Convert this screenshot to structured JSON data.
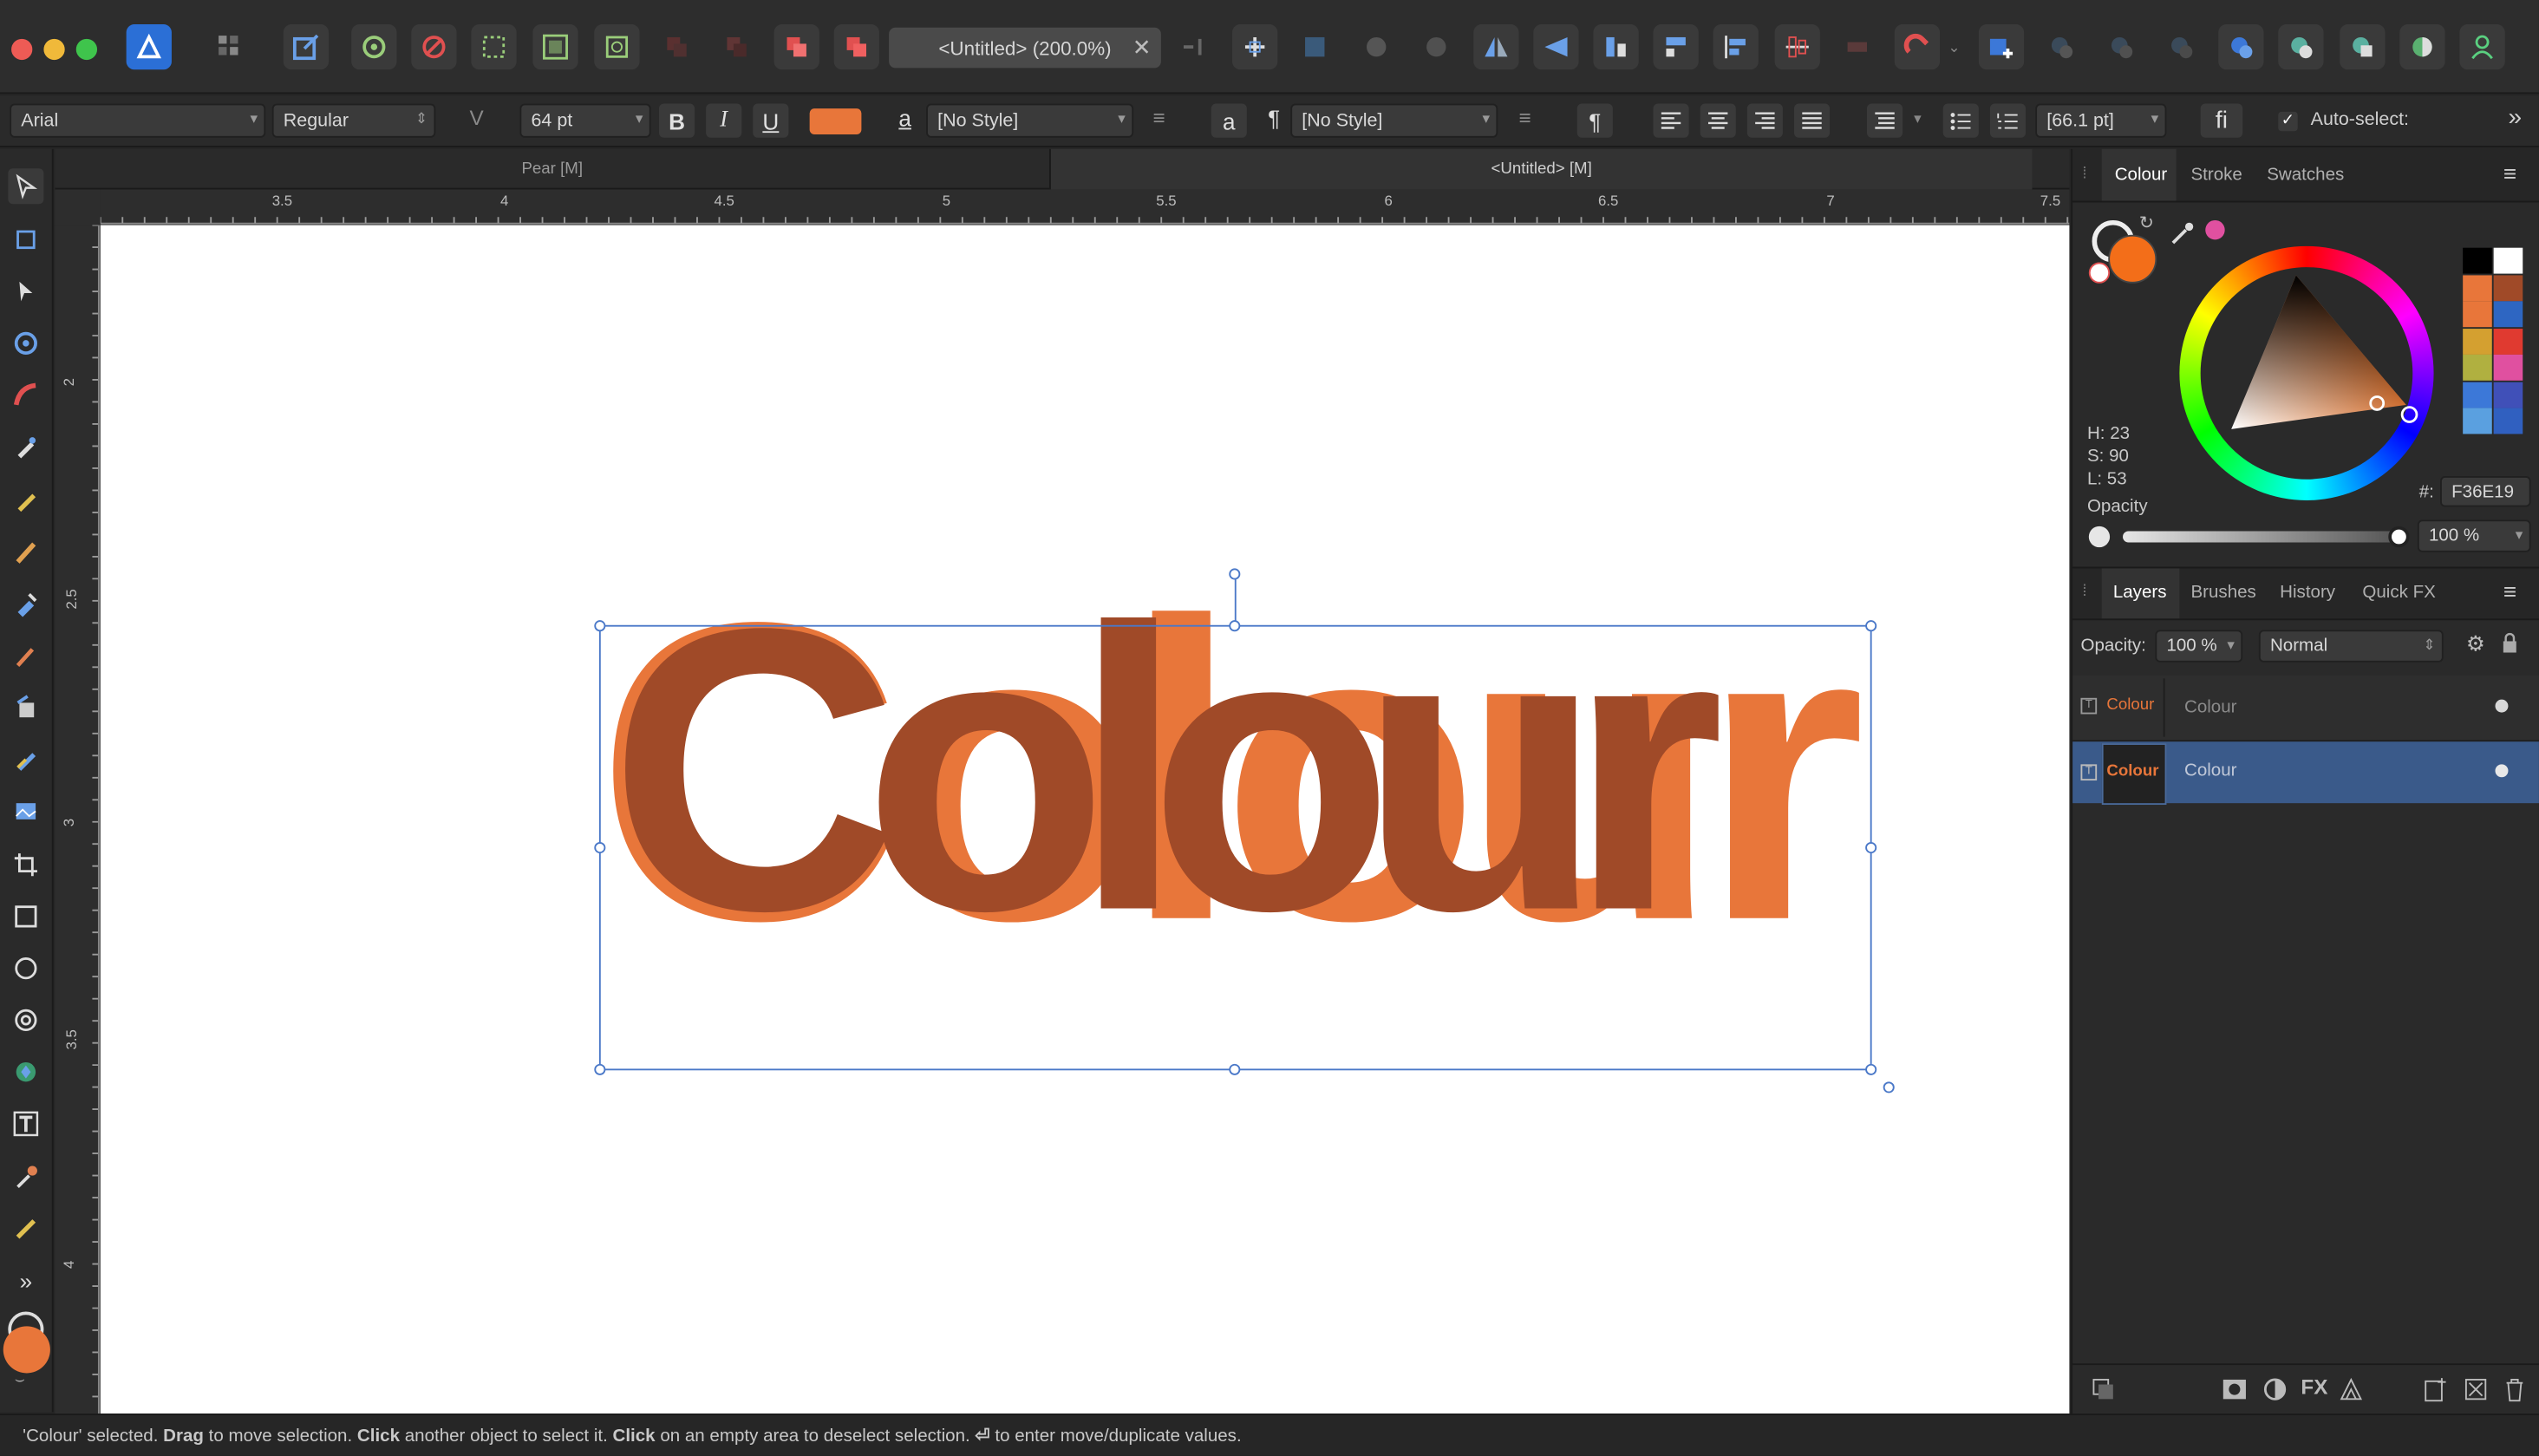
{
  "toolbar": {
    "document_title": "<Untitled> (200.0%)",
    "close_glyph": "✕"
  },
  "context_bar": {
    "font_family": "Arial",
    "font_style": "Regular",
    "font_size": "64 pt",
    "bold": "B",
    "italic": "I",
    "underline": "U",
    "fill_color": "#E8763A",
    "char_style_glyph": "a",
    "char_style": "[No Style]",
    "char_style2_glyph": "a",
    "para_glyph": "¶",
    "para_style": "[No Style]",
    "pilcrow_btn": "¶",
    "leading": "[66.1 pt]",
    "ligature": "fi",
    "auto_select_label": "Auto-select:",
    "more_glyph": "»"
  },
  "doc_tabs": [
    {
      "label": "Pear  [M]"
    },
    {
      "label": "<Untitled> [M]"
    }
  ],
  "ruler": {
    "unit": "in",
    "h_labels": [
      "3.5",
      "4",
      "4.5",
      "5",
      "5.5",
      "6",
      "6.5",
      "7",
      "7.5"
    ],
    "v_labels": [
      "2",
      "2.5",
      "3",
      "3.5",
      "4"
    ]
  },
  "canvas": {
    "text": "Colour",
    "colors": {
      "light": "#E8763A",
      "dark": "#A04A28"
    }
  },
  "colour_panel": {
    "tabs": [
      "Colour",
      "Stroke",
      "Swatches"
    ],
    "h": "H: 23",
    "s": "S: 90",
    "l": "L: 53",
    "hex_label": "#:",
    "hex_value": "F36E19",
    "opacity_label": "Opacity",
    "opacity_value": "100 %",
    "swatches": [
      "#000000",
      "#ffffff",
      "#E8763A",
      "#A04A28",
      "#E8763A",
      "#2E66C2",
      "#D4A030",
      "#E03A30",
      "#B0B040",
      "#E050A0",
      "#3C78D8",
      "#4050B8",
      "#5AA0E0",
      "#3060C0"
    ]
  },
  "layers_panel": {
    "tabs": [
      "Layers",
      "Brushes",
      "History",
      "Quick FX"
    ],
    "opacity_label": "Opacity:",
    "opacity_value": "100 %",
    "blend_mode": "Normal",
    "layers": [
      {
        "thumb": "Colour",
        "name": "Colour",
        "selected": false
      },
      {
        "thumb": "Colour",
        "name": "Colour",
        "selected": true
      }
    ]
  },
  "status": {
    "s1": "'Colour' selected. ",
    "b1": "Drag",
    "s2": " to move selection. ",
    "b2": "Click",
    "s3": " another object to select it. ",
    "b3": "Click",
    "s4": " on an empty area to deselect selection. ",
    "b4": "⏎",
    "s5": " to enter move/duplicate values."
  }
}
